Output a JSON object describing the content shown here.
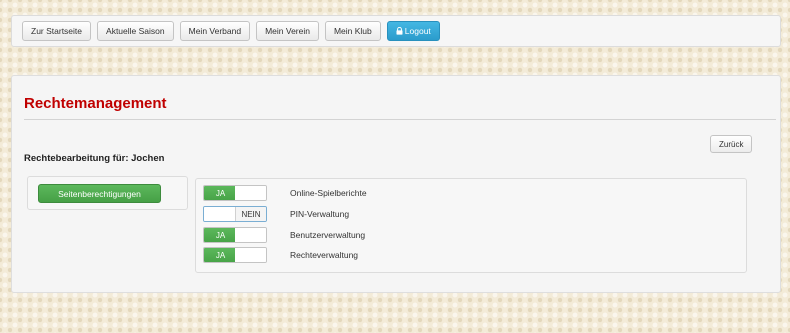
{
  "nav": {
    "items": [
      {
        "name": "nav-home-button",
        "label": "Zur Startseite"
      },
      {
        "name": "nav-season-button",
        "label": "Aktuelle Saison"
      },
      {
        "name": "nav-federation-button",
        "label": "Mein Verband"
      },
      {
        "name": "nav-association-button",
        "label": "Mein Verein"
      },
      {
        "name": "nav-club-button",
        "label": "Mein Klub"
      }
    ],
    "logout_label": "Logout",
    "logout_icon": "lock-icon",
    "logout_color": "#2b9ccc"
  },
  "page": {
    "title": "Rechtemanagement",
    "title_color": "#c00000",
    "back_label": "Zurück",
    "subheading": "Rechtebearbeitung für: Jochen"
  },
  "sidebar": {
    "button_label": "Seitenberechtigungen",
    "button_color": "#5cb85c"
  },
  "permissions": [
    {
      "label": "Online-Spielberichte",
      "enabled": true,
      "value_text": "JA"
    },
    {
      "label": "PIN-Verwaltung",
      "enabled": false,
      "value_text": "NEIN"
    },
    {
      "label": "Benutzerverwaltung",
      "enabled": true,
      "value_text": "JA"
    },
    {
      "label": "Rechteverwaltung",
      "enabled": true,
      "value_text": "JA"
    }
  ]
}
